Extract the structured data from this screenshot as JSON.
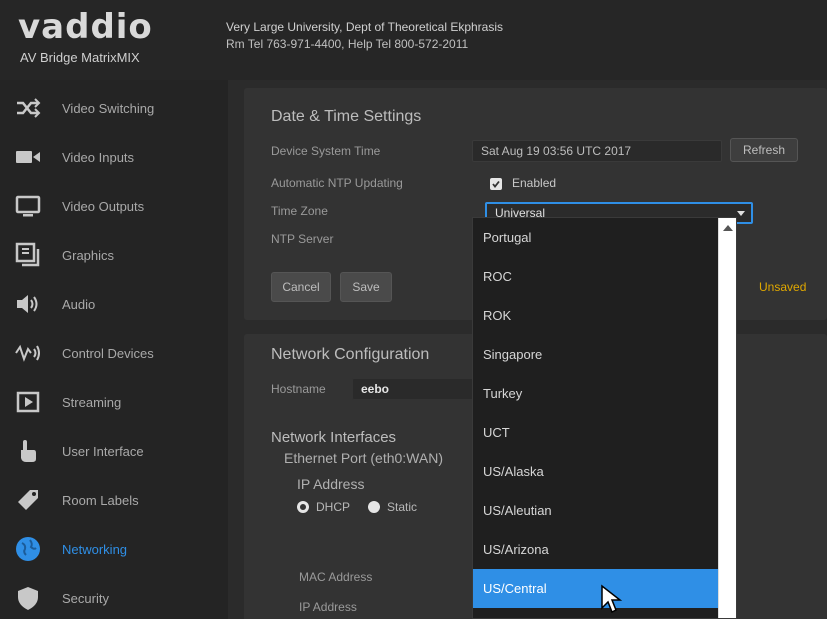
{
  "brand": {
    "logo_text": "vaddio",
    "product": "AV Bridge MatrixMIX"
  },
  "organization": {
    "line1": "Very Large University, Dept of Theoretical Ekphrasis",
    "line2": "Rm Tel 763-971-4400, Help Tel 800-572-2011"
  },
  "sidebar": {
    "items": [
      {
        "label": "Video Switching",
        "icon": "shuffle-icon"
      },
      {
        "label": "Video Inputs",
        "icon": "camera-icon"
      },
      {
        "label": "Video Outputs",
        "icon": "monitor-icon"
      },
      {
        "label": "Graphics",
        "icon": "graphics-icon"
      },
      {
        "label": "Audio",
        "icon": "speaker-icon"
      },
      {
        "label": "Control Devices",
        "icon": "control-icon"
      },
      {
        "label": "Streaming",
        "icon": "play-icon"
      },
      {
        "label": "User Interface",
        "icon": "hand-icon"
      },
      {
        "label": "Room Labels",
        "icon": "tag-icon"
      },
      {
        "label": "Networking",
        "icon": "globe-icon"
      },
      {
        "label": "Security",
        "icon": "shield-icon"
      }
    ],
    "active_index": 9,
    "active_color": "#2f8fe6"
  },
  "datetime": {
    "title": "Date & Time Settings",
    "device_time_label": "Device System Time",
    "device_time_value": "Sat Aug 19 03:56 UTC 2017",
    "refresh_label": "Refresh",
    "ntp_update_label": "Automatic NTP Updating",
    "ntp_enabled": true,
    "enabled_label": "Enabled",
    "timezone_label": "Time Zone",
    "timezone_value": "Universal",
    "ntp_server_label": "NTP Server",
    "cancel_label": "Cancel",
    "save_label": "Save",
    "unsaved_label": "Unsaved",
    "unsaved_color": "#e0a800"
  },
  "network": {
    "title": "Network Configuration",
    "hostname_label": "Hostname",
    "hostname_value": "eebo",
    "interfaces_title": "Network Interfaces",
    "port_title": "Ethernet Port (eth0:WAN)",
    "ip_address_title": "IP Address",
    "dhcp_label": "DHCP",
    "static_label": "Static",
    "mac_label": "MAC Address",
    "ip_label": "IP Address"
  },
  "timezone_options": [
    "Portugal",
    "ROC",
    "ROK",
    "Singapore",
    "Turkey",
    "UCT",
    "US/Alaska",
    "US/Aleutian",
    "US/Arizona",
    "US/Central"
  ],
  "timezone_selected_index": 9,
  "accent_color": "#2f8fe6"
}
